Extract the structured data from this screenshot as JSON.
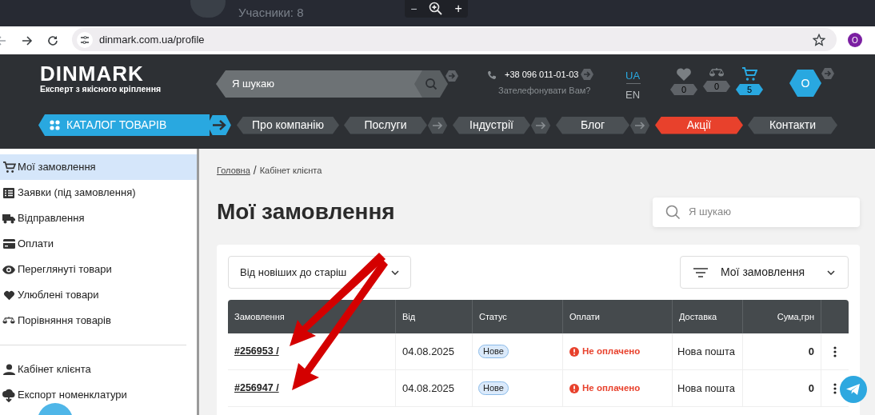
{
  "browser": {
    "meeting_label": "Учасники: 8",
    "zoom_out": "−",
    "zoom_in": "+",
    "url": "dinmark.com.ua/profile",
    "profile_initial": "O"
  },
  "header": {
    "logo": "DINMARK",
    "tagline": "Експерт з якісного кріплення",
    "search_placeholder": "Я шукаю",
    "phone": "+38 096 011-01-03",
    "callback": "Зателефонувати Вам?",
    "languages": [
      {
        "label": "UA",
        "selected": true
      },
      {
        "label": "EN",
        "selected": false
      }
    ],
    "counters": [
      {
        "kind": "favorites",
        "count": "0",
        "highlighted": false
      },
      {
        "kind": "compare",
        "count": "0",
        "highlighted": false
      },
      {
        "kind": "cart",
        "count": "5",
        "highlighted": true
      }
    ],
    "user_initial": "О"
  },
  "nav": {
    "catalog": "КАТАЛОГ ТОВАРІВ",
    "items": [
      {
        "label": "Про компанію",
        "has_arrow": false,
        "highlighted": false
      },
      {
        "label": "Послуги",
        "has_arrow": true,
        "highlighted": false
      },
      {
        "label": "Індустрії",
        "has_arrow": true,
        "highlighted": false
      },
      {
        "label": "Блог",
        "has_arrow": true,
        "highlighted": false
      },
      {
        "label": "Акції",
        "has_arrow": false,
        "highlighted": true
      },
      {
        "label": "Контакти",
        "has_arrow": false,
        "highlighted": false
      }
    ]
  },
  "sidebar": {
    "items": [
      {
        "kind": "cart",
        "label": "Мої замовлення",
        "selected": true
      },
      {
        "kind": "list",
        "label": "Заявки (під замовлення)",
        "selected": false
      },
      {
        "kind": "truck",
        "label": "Відправлення",
        "selected": false
      },
      {
        "kind": "card",
        "label": "Оплати",
        "selected": false
      },
      {
        "kind": "eye",
        "label": "Переглянуті товари",
        "selected": false
      },
      {
        "kind": "heart",
        "label": "Улюблені товари",
        "selected": false
      },
      {
        "kind": "scales",
        "label": "Порівняння товарів",
        "selected": false
      }
    ],
    "secondary_items": [
      {
        "kind": "user",
        "label": "Кабінет клієнта",
        "selected": false
      },
      {
        "kind": "download",
        "label": "Експорт номенклатури",
        "selected": false
      }
    ]
  },
  "breadcrumb": {
    "items": [
      "Головна",
      "Кабінет клієнта"
    ],
    "separator": "/"
  },
  "page_title": "Мої замовлення",
  "search_placeholder": "Я шукаю",
  "sort": "Від новіших до старіш",
  "filter": "Мої замовлення",
  "table": {
    "columns": [
      "Замовлення",
      "Від",
      "Статус",
      "Оплати",
      "Доставка",
      "Сума,грн"
    ],
    "rows": [
      {
        "order": "#256953 /",
        "date": "04.08.2025",
        "status": "Нове",
        "payment": "Не оплачено",
        "delivery": "Нова пошта",
        "sum": "0"
      },
      {
        "order": "#256947 /",
        "date": "04.08.2025",
        "status": "Нове",
        "payment": "Не оплачено",
        "delivery": "Нова пошта",
        "sum": "0"
      }
    ]
  }
}
